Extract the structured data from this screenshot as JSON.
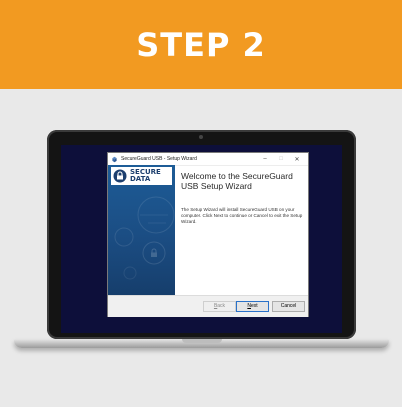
{
  "banner": {
    "title": "STEP 2",
    "color": "#f29a21"
  },
  "window": {
    "title": "SecureGuard USB - Setup Wizard",
    "minimize": "–",
    "maximize": "□",
    "close": "✕"
  },
  "logo": {
    "line1": "SECURE",
    "line2": "DATA"
  },
  "main": {
    "welcome": "Welcome to the SecureGuard USB Setup Wizard",
    "description": "The Setup Wizard will install SecureGuard USB on your computer. Click Next to continue or Cancel to exit the Setup Wizard."
  },
  "buttons": {
    "back": {
      "mnemonic": "B",
      "rest": "ack"
    },
    "next": {
      "mnemonic": "N",
      "rest": "ext"
    },
    "cancel": "Cancel"
  },
  "icons": [
    "app-icon",
    "secure-data-logo-icon",
    "lock-icon"
  ]
}
